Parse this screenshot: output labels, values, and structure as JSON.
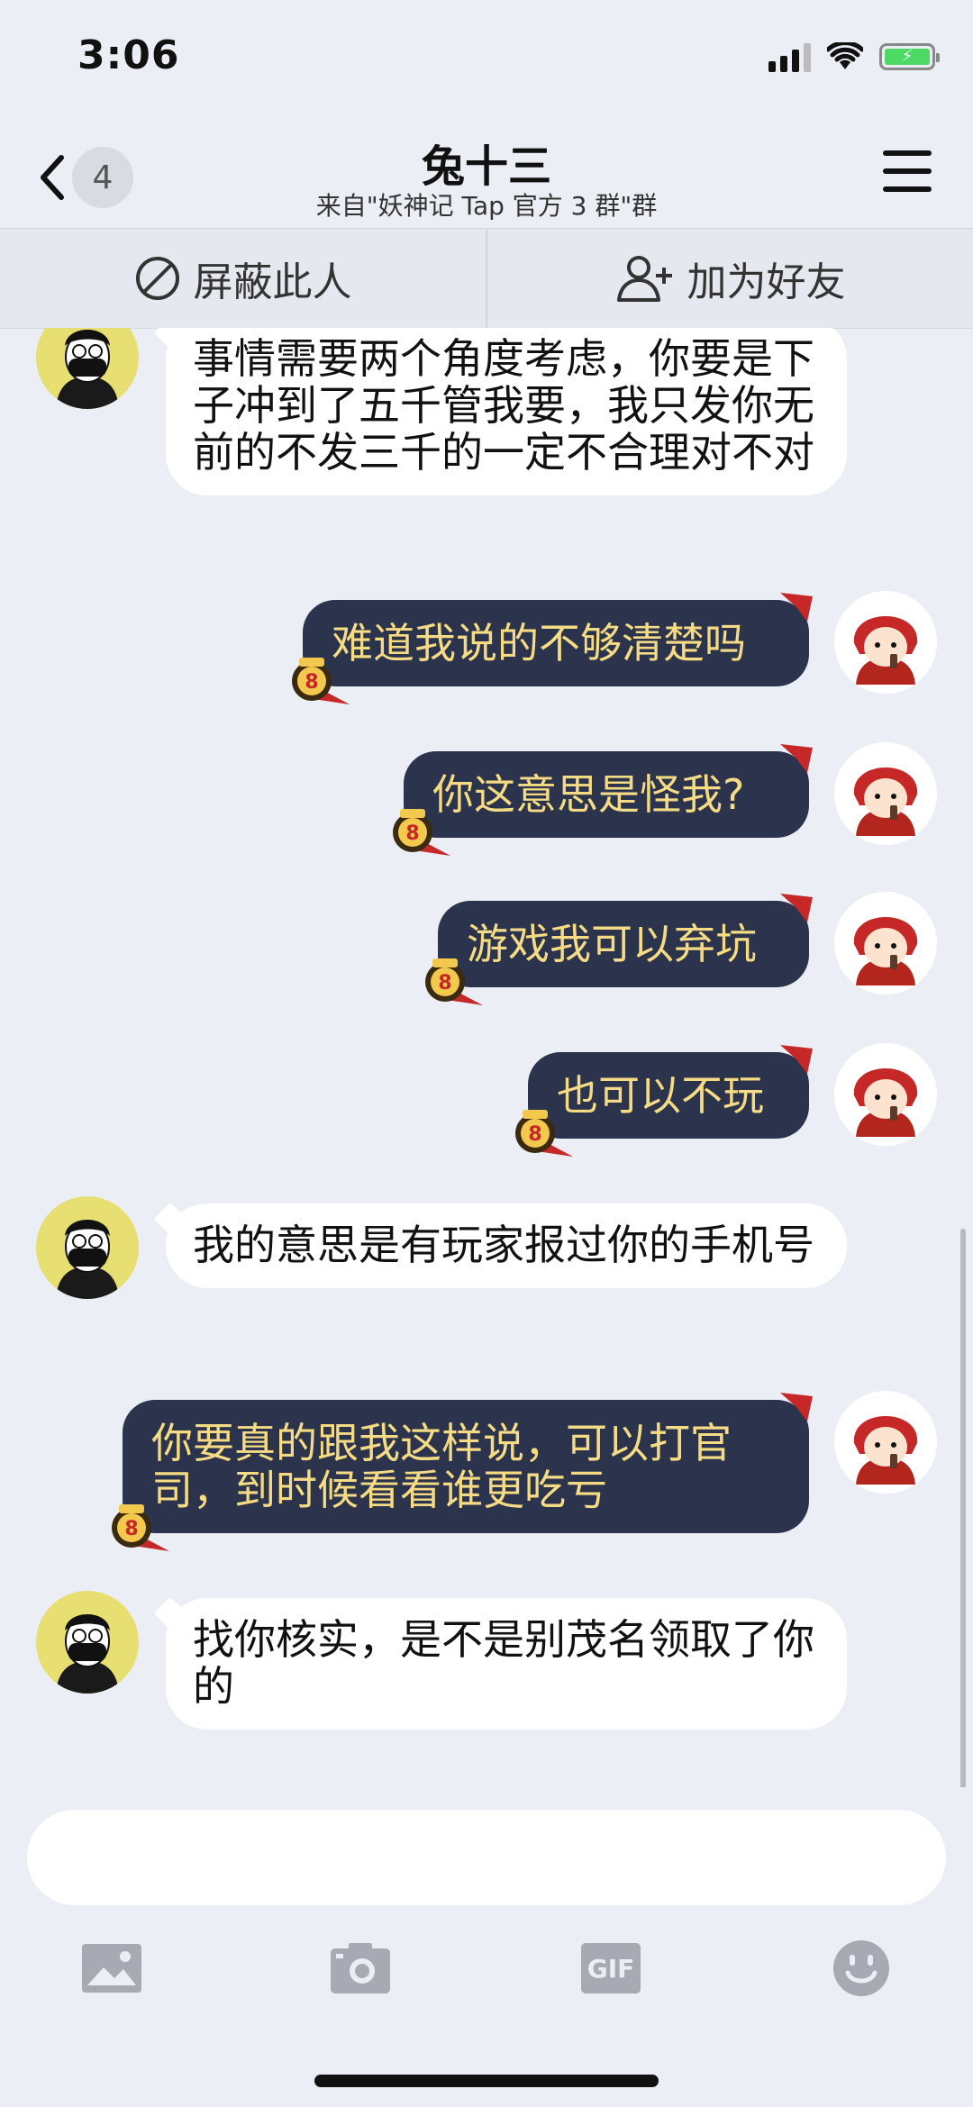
{
  "status_bar": {
    "time": "3:06",
    "battery_color": "#4cd964"
  },
  "header": {
    "back_count": "4",
    "title": "兔十三",
    "subtitle": "来自\"妖神记 Tap 官方 3 群\"群"
  },
  "actions": {
    "block_label": "屏蔽此人",
    "add_friend_label": "加为好友"
  },
  "messages": [
    {
      "side": "in",
      "text": "事情需要两个角度考虑，你要是下子冲到了五千管我要，我只发你无前的不发三千的一定不合理对不对"
    },
    {
      "side": "out",
      "text": "难道我说的不够清楚吗"
    },
    {
      "side": "out",
      "text": "你这意思是怪我?"
    },
    {
      "side": "out",
      "text": "游戏我可以弃坑"
    },
    {
      "side": "out",
      "text": "也可以不玩"
    },
    {
      "side": "in",
      "text": "我的意思是有玩家报过你的手机号"
    },
    {
      "side": "out",
      "text": "你要真的跟我这样说，可以打官司，到时候看看谁更吃亏"
    },
    {
      "side": "in",
      "text": "找你核实，是不是别茂名领取了你的"
    }
  ],
  "input": {
    "placeholder": ""
  },
  "toolbar": {
    "gif_label": "GIF"
  },
  "colors": {
    "background": "#eceef5",
    "outgoing_bubble": "#2b334d",
    "outgoing_text": "#f5dc84",
    "incoming_bubble": "#ffffff"
  },
  "icons": [
    "back-chevron-icon",
    "menu-icon",
    "block-icon",
    "add-friend-icon",
    "image-icon",
    "camera-icon",
    "gif-icon",
    "emoji-icon"
  ]
}
